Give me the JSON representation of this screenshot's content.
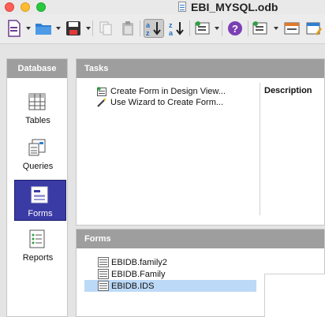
{
  "window": {
    "title": "EBI_MYSQL.odb"
  },
  "toolbar": {
    "icons": [
      "new-document-icon",
      "open-folder-icon",
      "save-icon",
      "copy-icon",
      "paste-icon",
      "sort-ascending-icon",
      "sort-descending-icon",
      "new-form-icon",
      "help-icon",
      "form-wizard-icon",
      "form-view-icon",
      "form-edit-icon"
    ]
  },
  "left": {
    "header": "Database",
    "items": [
      {
        "label": "Tables",
        "icon": "table-icon"
      },
      {
        "label": "Queries",
        "icon": "query-icon"
      },
      {
        "label": "Forms",
        "icon": "form-icon"
      },
      {
        "label": "Reports",
        "icon": "report-icon"
      }
    ]
  },
  "tasks": {
    "header": "Tasks",
    "items": [
      {
        "label": "Create Form in Design View...",
        "icon": "design-view-icon"
      },
      {
        "label": "Use Wizard to Create Form...",
        "icon": "wizard-wand-icon"
      }
    ],
    "description_label": "Description"
  },
  "forms": {
    "header": "Forms",
    "items": [
      {
        "label": "EBIDB.family2"
      },
      {
        "label": "EBIDB.Family"
      },
      {
        "label": "EBIDB.IDS"
      }
    ]
  },
  "colors": {
    "active_nav": "#3b3ba6",
    "selection": "#bcd9f7",
    "panel_header": "#9e9e9e"
  }
}
